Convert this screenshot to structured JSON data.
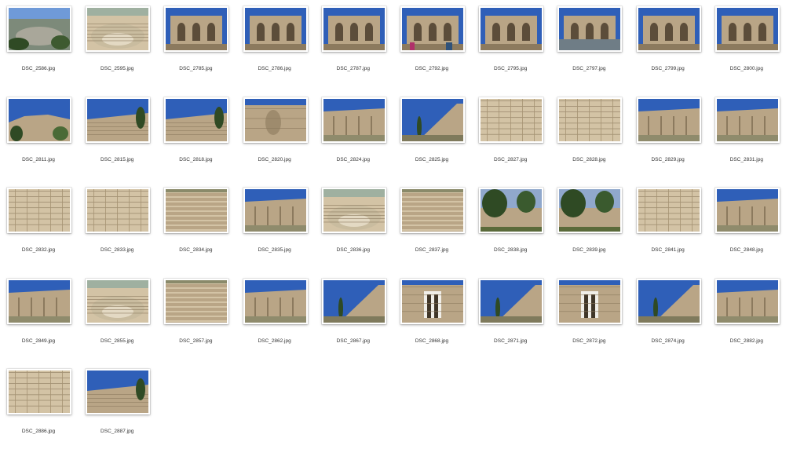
{
  "files": [
    {
      "name": "DSC_2586.jpg",
      "scene": "valley"
    },
    {
      "name": "DSC_2595.jpg",
      "scene": "theater"
    },
    {
      "name": "DSC_2785.jpg",
      "scene": "arches"
    },
    {
      "name": "DSC_2786.jpg",
      "scene": "arches"
    },
    {
      "name": "DSC_2787.jpg",
      "scene": "arches"
    },
    {
      "name": "DSC_2792.jpg",
      "scene": "arches-people"
    },
    {
      "name": "DSC_2795.jpg",
      "scene": "arches"
    },
    {
      "name": "DSC_2797.jpg",
      "scene": "arches-wide"
    },
    {
      "name": "DSC_2799.jpg",
      "scene": "arches"
    },
    {
      "name": "DSC_2800.jpg",
      "scene": "arches"
    },
    {
      "name": "DSC_2811.jpg",
      "scene": "hill"
    },
    {
      "name": "DSC_2815.jpg",
      "scene": "ruins-sky"
    },
    {
      "name": "DSC_2818.jpg",
      "scene": "ruins-sky"
    },
    {
      "name": "DSC_2820.jpg",
      "scene": "statue"
    },
    {
      "name": "DSC_2824.jpg",
      "scene": "cliff"
    },
    {
      "name": "DSC_2825.jpg",
      "scene": "cliff-side"
    },
    {
      "name": "DSC_2827.jpg",
      "scene": "stone"
    },
    {
      "name": "DSC_2828.jpg",
      "scene": "stone"
    },
    {
      "name": "DSC_2829.jpg",
      "scene": "cliff"
    },
    {
      "name": "DSC_2831.jpg",
      "scene": "cliff"
    },
    {
      "name": "DSC_2832.jpg",
      "scene": "stone"
    },
    {
      "name": "DSC_2833.jpg",
      "scene": "stone"
    },
    {
      "name": "DSC_2834.jpg",
      "scene": "stone-steps"
    },
    {
      "name": "DSC_2835.jpg",
      "scene": "cliff"
    },
    {
      "name": "DSC_2836.jpg",
      "scene": "theater"
    },
    {
      "name": "DSC_2837.jpg",
      "scene": "stone-steps"
    },
    {
      "name": "DSC_2838.jpg",
      "scene": "trees-ruins"
    },
    {
      "name": "DSC_2839.jpg",
      "scene": "trees-ruins"
    },
    {
      "name": "DSC_2841.jpg",
      "scene": "stone"
    },
    {
      "name": "DSC_2848.jpg",
      "scene": "cliff"
    },
    {
      "name": "DSC_2849.jpg",
      "scene": "cliff"
    },
    {
      "name": "DSC_2855.jpg",
      "scene": "theater"
    },
    {
      "name": "DSC_2857.jpg",
      "scene": "stone-steps"
    },
    {
      "name": "DSC_2862.jpg",
      "scene": "cliff"
    },
    {
      "name": "DSC_2867.jpg",
      "scene": "cliff-side"
    },
    {
      "name": "DSC_2868.jpg",
      "scene": "doorway"
    },
    {
      "name": "DSC_2871.jpg",
      "scene": "cliff-side"
    },
    {
      "name": "DSC_2872.jpg",
      "scene": "doorway"
    },
    {
      "name": "DSC_2874.jpg",
      "scene": "cliff-side"
    },
    {
      "name": "DSC_2882.jpg",
      "scene": "cliff"
    },
    {
      "name": "DSC_2886.jpg",
      "scene": "stone"
    },
    {
      "name": "DSC_2887.jpg",
      "scene": "ruins-sky"
    }
  ],
  "colors": {
    "sky": "#2f5fb8",
    "sky_light": "#6f9ad8",
    "stone": "#b9a586",
    "stone_dark": "#8c7a5e",
    "stone_light": "#d3c3a5",
    "tree": "#2f4a24",
    "label": "#333333"
  }
}
